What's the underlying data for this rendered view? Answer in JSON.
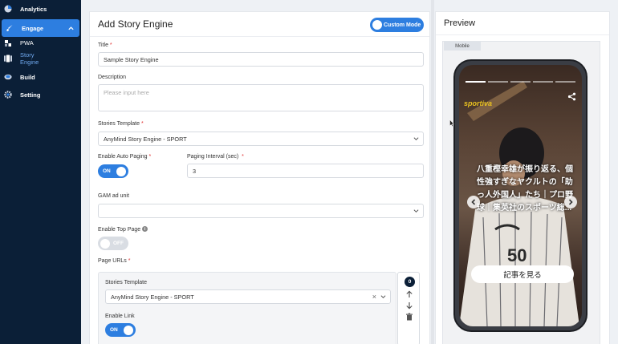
{
  "sidebar": {
    "items": [
      {
        "label": "Analytics",
        "icon": "chart-pie-icon"
      },
      {
        "label": "Engage",
        "icon": "brush-icon",
        "active": true
      },
      {
        "label": "PWA",
        "icon": "pwa-icon"
      },
      {
        "label": "Story Engine",
        "icon": "story-icon",
        "selected": true
      },
      {
        "label": "Build",
        "icon": "build-icon"
      },
      {
        "label": "Setting",
        "icon": "gear-icon"
      }
    ]
  },
  "form": {
    "heading": "Add Story Engine",
    "mode_label": "Custom Mode",
    "title_label": "Title",
    "title_value": "Sample Story Engine",
    "description_label": "Description",
    "description_placeholder": "Please input here",
    "stories_template_label": "Stories Template",
    "stories_template_value": "AnyMind Story Engine - SPORT",
    "auto_paging_label": "Enable Auto Paging",
    "auto_paging_state": "ON",
    "paging_interval_label": "Paging Interval (sec)",
    "paging_interval_value": "3",
    "gam_label": "GAM ad unit",
    "gam_value": "",
    "top_page_label": "Enable Top Page",
    "top_page_state": "OFF",
    "page_urls_label": "Page URLs",
    "required_mark": "*",
    "url_item": {
      "template_label": "Stories Template",
      "template_value": "AnyMind Story Engine - SPORT",
      "link_label": "Enable Link",
      "link_state": "ON",
      "index": "0"
    }
  },
  "preview": {
    "heading": "Preview",
    "tab": "Mobile",
    "brand": "sportiva",
    "headline": "八重樫幸雄が振り返る、個性強すぎなヤクルトの「助っ人外国人」たち｜プロ野球｜集英社のスポーツ総...",
    "cta": "記事を見る"
  },
  "colors": {
    "sidebar_bg": "#0b1f37",
    "accent": "#2d7ee0"
  }
}
